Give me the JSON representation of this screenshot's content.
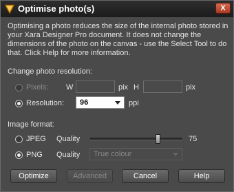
{
  "window": {
    "title": "Optimise photo(s)",
    "close_label": "X"
  },
  "description": "Optimising a photo reduces the size of the internal photo stored in your Xara Designer Pro document. It does not change the dimensions of the photo on the canvas - use the Select Tool to do that. Click Help for more information.",
  "resolution_section": {
    "heading": "Change photo resolution:",
    "pixels_label": "Pixels:",
    "w_label": "W",
    "w_value": "",
    "w_unit": "pix",
    "h_label": "H",
    "h_value": "",
    "h_unit": "pix",
    "resolution_label": "Resolution:",
    "resolution_value": "96",
    "resolution_unit": "ppi",
    "selected_option": "Resolution"
  },
  "format_section": {
    "heading": "Image format:",
    "jpeg_label": "JPEG",
    "jpeg_quality_label": "Quality",
    "jpeg_quality_value": "75",
    "jpeg_quality_fraction": 0.75,
    "png_label": "PNG",
    "png_quality_label": "Quality",
    "png_quality_value": "True colour",
    "selected_option": "PNG"
  },
  "buttons": {
    "optimize": "Optimize",
    "advanced": "Advanced",
    "cancel": "Cancel",
    "help": "Help"
  },
  "icons": {
    "app": "xara-app-icon",
    "close": "close-icon",
    "dropdown": "chevron-down-icon"
  }
}
